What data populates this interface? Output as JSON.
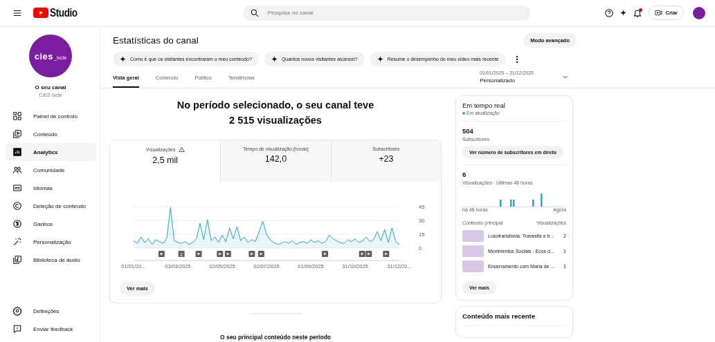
{
  "header": {
    "logo_text": "Studio",
    "search": {
      "placeholder": "Pesquise no canal"
    },
    "create_button": "Criar",
    "notification_badge": true
  },
  "sidebar": {
    "channel": {
      "logo_main": "cies",
      "logo_sub": "_iscte",
      "title": "O seu canal",
      "name": "CIES Iscte"
    },
    "items": [
      {
        "label": "Painel de controlo",
        "selected": false
      },
      {
        "label": "Conteúdo",
        "selected": false
      },
      {
        "label": "Analytics",
        "selected": true
      },
      {
        "label": "Comunidade",
        "selected": false
      },
      {
        "label": "Idiomas",
        "selected": false
      },
      {
        "label": "Deteção de conteúdo",
        "selected": false
      },
      {
        "label": "Ganhos",
        "selected": false
      },
      {
        "label": "Personalização",
        "selected": false
      },
      {
        "label": "Biblioteca de áudio",
        "selected": false
      }
    ],
    "bottom_items": [
      {
        "label": "Definições"
      },
      {
        "label": "Enviar feedback"
      }
    ]
  },
  "page": {
    "title": "Estatísticas do canal",
    "advanced_button": "Modo avançado",
    "suggestions": [
      "Como é que os visitantes encontraram o meu conteúdo?",
      "Quantos novos visitantes alcancei?",
      "Resume o desempenho do meu vídeo mais recente"
    ],
    "tabs": [
      {
        "label": "Vista geral",
        "selected": true
      },
      {
        "label": "Conteúdo",
        "selected": false
      },
      {
        "label": "Público",
        "selected": false
      },
      {
        "label": "Tendências",
        "selected": false
      }
    ],
    "date_range": {
      "range": "01/01/2025 – 31/12/2025",
      "preset": "Personalizado"
    }
  },
  "overview": {
    "headline_1": "No período selecionado, o seu canal teve",
    "headline_2": "2 515 visualizações",
    "metrics": [
      {
        "label": "Visualizações",
        "value": "2,5 mil",
        "warning": true,
        "selected": true
      },
      {
        "label": "Tempo de visualização (horas)",
        "value": "142,0",
        "warning": false,
        "selected": false
      },
      {
        "label": "Subscritores",
        "value": "+23",
        "warning": false,
        "selected": false
      }
    ],
    "chart_data": {
      "type": "area",
      "ylim": [
        0,
        45
      ],
      "yticks": [
        0,
        15,
        30,
        45
      ],
      "categories": [
        "01/01/20...",
        null,
        null,
        null,
        null,
        null,
        null,
        null,
        null,
        null,
        null,
        null,
        "03/03/2025",
        null,
        null,
        null,
        null,
        null,
        null,
        null,
        null,
        null,
        null,
        null,
        "02/05/2025",
        null,
        null,
        null,
        null,
        null,
        null,
        null,
        null,
        null,
        null,
        null,
        "02/07/2025",
        null,
        null,
        null,
        null,
        null,
        null,
        null,
        null,
        null,
        null,
        null,
        "01/09/2025",
        null,
        null,
        null,
        null,
        null,
        null,
        null,
        null,
        null,
        null,
        null,
        "31/10/2025",
        null,
        null,
        null,
        null,
        null,
        null,
        null,
        null,
        null,
        null,
        null,
        "31/12/20..."
      ],
      "series": [
        {
          "color": "#27a4d6",
          "values": [
            8,
            5,
            12,
            6,
            10,
            4,
            9,
            7,
            5,
            11,
            44,
            8,
            6,
            5,
            7,
            4,
            6,
            10,
            27,
            9,
            31,
            8,
            12,
            6,
            14,
            7,
            22,
            10,
            23,
            8,
            12,
            6,
            9,
            7,
            18,
            29,
            15,
            9,
            6,
            4,
            5,
            7,
            5,
            8,
            4,
            6,
            7,
            5,
            9,
            6,
            8,
            5,
            7,
            14,
            10,
            8,
            6,
            5,
            9,
            7,
            10,
            6,
            8,
            12,
            7,
            9,
            18,
            8,
            20,
            6,
            22,
            7,
            4
          ]
        }
      ]
    },
    "video_markers": [
      {
        "kind": "play"
      },
      {
        "kind": "count",
        "label": "2"
      },
      {
        "kind": "play"
      },
      {
        "kind": "play"
      },
      {
        "kind": "play"
      },
      {
        "kind": "play"
      },
      {
        "kind": "play"
      },
      {
        "kind": "play"
      },
      {
        "kind": "play"
      },
      {
        "kind": "play"
      },
      {
        "kind": "play"
      }
    ],
    "more_button": "Ver mais",
    "top_content_title": "O seu principal conteúdo neste período"
  },
  "realtime": {
    "title": "Em tempo real",
    "status": "Em atualização",
    "subscribers": "504",
    "subscribers_label": "Subscritores",
    "live_button": "Ver número de subscritores em direto",
    "views": "6",
    "views_label": "Visualizações · Últimas 48 horas",
    "axis_start": "há 48 horas",
    "axis_end": "Agora",
    "col_content": "Conteúdo principal",
    "col_views": "Visualizações",
    "rows": [
      {
        "title": "Lusotransfonia: Travestis e tr...",
        "views": "2"
      },
      {
        "title": "Movimentos Sociais - Ecos d...",
        "views": "1"
      },
      {
        "title": "Encerramento com Maria de ...",
        "views": "1"
      }
    ],
    "more_button": "Ver mais"
  },
  "latest": {
    "title": "Conteúdo mais recente"
  }
}
